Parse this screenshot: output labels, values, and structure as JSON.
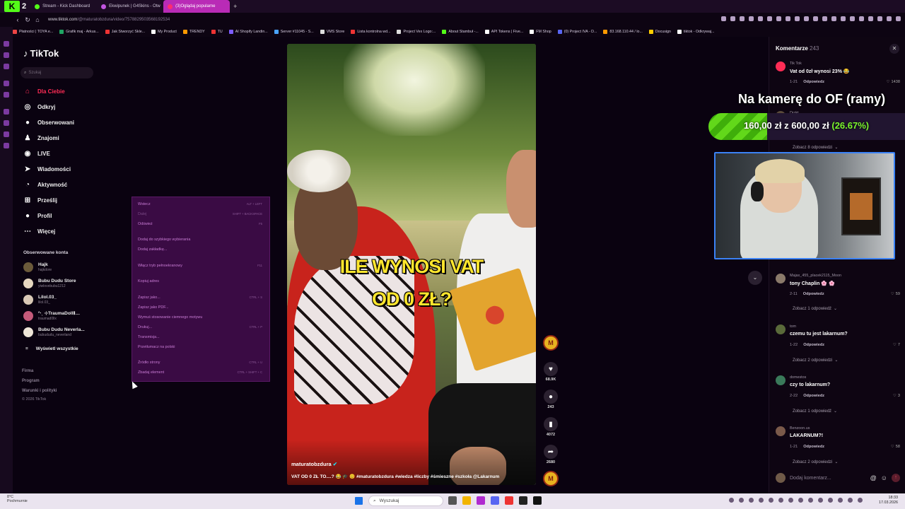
{
  "browser": {
    "tabs": [
      {
        "label": "Stream - Kick Dashboard",
        "color": "#53fc18",
        "active": false
      },
      {
        "label": "Ekwipunek | G4Skins - Otw",
        "color": "#c255e0",
        "active": false
      },
      {
        "label": "(3)Oglądaj popularne",
        "color": "#ff2d6f",
        "active": true
      }
    ],
    "kick_badge": "K",
    "kick_count": "2",
    "new_tab": "+",
    "url_host": "www.tiktok.com",
    "url_path": "/@maturatobzdura/video/7578829503568192534",
    "bookmarks": [
      {
        "label": "Płatności | TOYA e...",
        "color": "#e44"
      },
      {
        "label": "Grafik maj - Arkus...",
        "color": "#1fa463"
      },
      {
        "label": "Jak Stworzyć Skle...",
        "color": "#e33"
      },
      {
        "label": "My Product",
        "color": "#fff"
      },
      {
        "label": "TRENDY",
        "color": "#f90"
      },
      {
        "label": "TU",
        "color": "#e33"
      },
      {
        "label": "AI Shopify Landin...",
        "color": "#7c5cff"
      },
      {
        "label": "Server #11045 - S...",
        "color": "#4aa3ff"
      },
      {
        "label": "VMS Store",
        "color": "#ddd"
      },
      {
        "label": "Lista kontrolna wd...",
        "color": "#e33"
      },
      {
        "label": "Project Vex Logo:...",
        "color": "#ddd"
      },
      {
        "label": "About Stambuł -...",
        "color": "#53fc18"
      },
      {
        "label": "API Tokens | Five...",
        "color": "#fff"
      },
      {
        "label": "FM Shop",
        "color": "#fff"
      },
      {
        "label": "(0) Project IVA - D...",
        "color": "#5865f2"
      },
      {
        "label": "83.168.110.44 / lo...",
        "color": "#f90"
      },
      {
        "label": "Docusign",
        "color": "#ffce00"
      },
      {
        "label": "tiktok - Odkrywaj...",
        "color": "#fff"
      }
    ]
  },
  "sidebar": {
    "logo": "TikTok",
    "search_placeholder": "Szukaj",
    "nav": [
      {
        "label": "Dla Ciebie",
        "icon": "home-icon",
        "glyph": "⌂",
        "active": true
      },
      {
        "label": "Odkryj",
        "icon": "compass-icon",
        "glyph": "◎",
        "active": false
      },
      {
        "label": "Obserwowani",
        "icon": "following-icon",
        "glyph": "●",
        "active": false
      },
      {
        "label": "Znajomi",
        "icon": "friends-icon",
        "glyph": "♟",
        "active": false
      },
      {
        "label": "LIVE",
        "icon": "live-icon",
        "glyph": "◉",
        "active": false
      },
      {
        "label": "Wiadomości",
        "icon": "messages-icon",
        "glyph": "➤",
        "active": false
      },
      {
        "label": "Aktywność",
        "icon": "activity-icon",
        "glyph": "◔",
        "active": false
      },
      {
        "label": "Prześlij",
        "icon": "upload-icon",
        "glyph": "⊞",
        "active": false
      },
      {
        "label": "Profil",
        "icon": "profile-icon",
        "glyph": "●",
        "active": false
      },
      {
        "label": "Więcej",
        "icon": "more-icon",
        "glyph": "⋯",
        "active": false
      }
    ],
    "followed_title": "Obserwowane konta",
    "accounts": [
      {
        "name": "Hajk",
        "handle": "hajkdore",
        "color": "#6b5a3a"
      },
      {
        "name": "Bubu Dudu Store",
        "handle": "yiwlovebubu1212",
        "color": "#e6d7c0"
      },
      {
        "name": "Lilol.03_",
        "handle": "lilol.03_",
        "color": "#d9c9b6"
      },
      {
        "name": "ᐢ‧ˎ ⊹TraumaDollⅡ…",
        "handle": "traumad0llx",
        "color": "#c45a7a"
      },
      {
        "name": "Bubu Dudu Neverla...",
        "handle": "bubududu_neverland",
        "color": "#efe6d8"
      }
    ],
    "see_all": "Wyświetl wszystkie",
    "footer": [
      "Firma",
      "Program",
      "Warunki i polityki",
      "© 2026 TikTok"
    ]
  },
  "context_menu": {
    "items": [
      {
        "label": "Wstecz",
        "shortcut": "ALT + LEFT",
        "disabled": false
      },
      {
        "label": "Dalej",
        "shortcut": "SHIFT + BACKSPACE",
        "disabled": true
      },
      {
        "label": "Odśwież",
        "shortcut": "F5",
        "disabled": false
      },
      {
        "label": "Dodaj do szybkiego wybierania",
        "shortcut": "",
        "disabled": false
      },
      {
        "label": "Dodaj zakładkę...",
        "shortcut": "",
        "disabled": false
      },
      {
        "label": "Włącz tryb pełnoekranowy",
        "shortcut": "F11",
        "disabled": false
      },
      {
        "label": "Kopiuj adres",
        "shortcut": "",
        "disabled": false
      },
      {
        "label": "Zapisz jako...",
        "shortcut": "CTRL + S",
        "disabled": false
      },
      {
        "label": "Zapisz jako PDF...",
        "shortcut": "",
        "disabled": false
      },
      {
        "label": "Wymuś stosowanie ciemnego motywu",
        "shortcut": "",
        "disabled": false
      },
      {
        "label": "Drukuj...",
        "shortcut": "CTRL + P",
        "disabled": false
      },
      {
        "label": "Transmisja...",
        "shortcut": "",
        "disabled": false
      },
      {
        "label": "Przetłumacz na polski",
        "shortcut": "",
        "disabled": false
      },
      {
        "label": "Źródło strony",
        "shortcut": "CTRL + U",
        "disabled": false
      },
      {
        "label": "Zbadaj element",
        "shortcut": "CTRL + SHIFT + C",
        "disabled": false
      }
    ]
  },
  "video": {
    "caption_line1": "ILE WYNOSI VAT",
    "caption_line2": "OD 0 ZŁ?",
    "author": "maturatobzdura",
    "description": "VAT OD 0 ZŁ TO....? 😂 🎓 😊 #maturatobzdura #wiedza #liczby #śmieszne #szkoła @Lakarnum",
    "actions": {
      "avatar_label": "M",
      "likes": "68.9K",
      "comments": "243",
      "saves": "4072",
      "shares": "2680",
      "sound_label": "M"
    }
  },
  "comments_panel": {
    "title": "Komentarze",
    "count": "243",
    "close": "✕",
    "scroll_down": "⌄",
    "items": [
      {
        "user": "Tik Tok",
        "text": "Vat od 0zł wynosi 23% 😂",
        "date": "1-21",
        "reply": "Odpowiedz",
        "likes": "1438",
        "avatar": "#fe2c55"
      },
      {
        "user": "Majax_455_placek2115_Moon",
        "text": "tony Chaplin 🌸 🌸",
        "date": "2-11",
        "reply": "Odpowiedz",
        "likes": "59",
        "avatar": "#8a7a6a"
      },
      {
        "user": "tom",
        "text": "czemu tu jest lakarnum?",
        "date": "1-22",
        "reply": "Odpowiedz",
        "likes": "7",
        "avatar": "#5a6a3a"
      },
      {
        "user": "domestos",
        "text": "czy to lakarnum?",
        "date": "2-22",
        "reply": "Odpowiedz",
        "likes": "3",
        "avatar": "#3a7a5a"
      },
      {
        "user": "Benzoon.us",
        "text": "LAKARNUM?!",
        "date": "1-21",
        "reply": "Odpowiedz",
        "likes": "58",
        "avatar": "#7a5a4a"
      }
    ],
    "partial_user": "Drzkt",
    "replies": [
      "Zobacz 8 odpowiedzi",
      "Zobacz 1 odpowiedź",
      "Zobacz 2 odpowiedzi",
      "Zobacz 1 odpowiedź",
      "Zobacz 2 odpowiedzi"
    ],
    "input_placeholder": "Dodaj komentarz...",
    "mention": "@",
    "emoji": "☺",
    "send": "↑"
  },
  "stream_overlay": {
    "title": "Na kamerę do OF (ramy)",
    "goal_current": "160,00 zł",
    "goal_sep": "z",
    "goal_target": "600,00 zł",
    "goal_percent_label": "(26.67%)",
    "goal_fraction": 0.2667
  },
  "taskbar": {
    "weather_temp": "8°C",
    "weather_desc": "Pochmurnie",
    "search_placeholder": "Wyszukaj",
    "time": "18:33",
    "date": "17.03.2026",
    "apps": [
      "#555",
      "#f2b400",
      "#b02bd0",
      "#5865f2",
      "#e33",
      "#222",
      "#111"
    ]
  }
}
